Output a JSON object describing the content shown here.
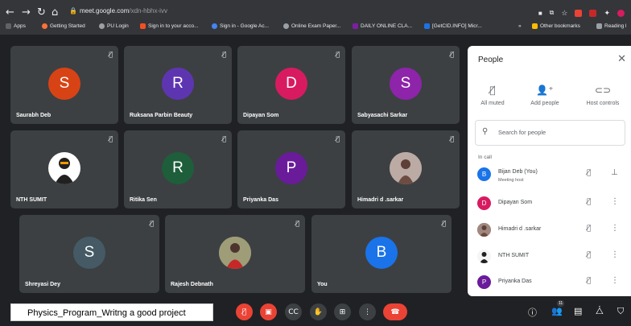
{
  "browser": {
    "url_host": "meet.google.com",
    "url_path": "/xdn-hbhx-ivv",
    "bookmarks": [
      {
        "label": "Apps",
        "color": "#5f6368"
      },
      {
        "label": "Getting Started",
        "color": "#ff7139"
      },
      {
        "label": "PU Login",
        "color": "#9aa0a6"
      },
      {
        "label": "Sign in to your acco...",
        "color": "#f25022"
      },
      {
        "label": "Sign in - Google Ac...",
        "color": "#4285f4"
      },
      {
        "label": "Online Exam Paper...",
        "color": "#9aa0a6"
      },
      {
        "label": "DAILY ONLINE CLA...",
        "color": "#7b1fa2"
      },
      {
        "label": "[GetCID.INFO] Micr...",
        "color": "#1a73e8"
      }
    ],
    "other_bookmarks": "Other bookmarks",
    "reading_list": "Reading l"
  },
  "tiles": [
    {
      "name": "Saurabh Deb",
      "initial": "S",
      "color": "#d84315"
    },
    {
      "name": "Ruksana Parbin Beauty",
      "initial": "R",
      "color": "#5e35b1"
    },
    {
      "name": "Dipayan Som",
      "initial": "D",
      "color": "#d81b60"
    },
    {
      "name": "Sabyasachi Sarkar",
      "initial": "S",
      "color": "#8e24aa"
    },
    {
      "name": "NTH SUMIT",
      "initial": "",
      "color": "#ffffff"
    },
    {
      "name": "Ritika Sen",
      "initial": "R",
      "color": "#1e5e3b"
    },
    {
      "name": "Priyanka Das",
      "initial": "P",
      "color": "#6a1b9a"
    },
    {
      "name": "Himadri d .sarkar",
      "initial": "",
      "color": "#8d6e63"
    },
    {
      "name": "Shreyasi Dey",
      "initial": "S",
      "color": "#455a64"
    },
    {
      "name": "Rajesh Debnath",
      "initial": "",
      "color": "#795548"
    },
    {
      "name": "You",
      "initial": "B",
      "color": "#1a73e8"
    }
  ],
  "people_panel": {
    "title": "People",
    "actions": [
      "All muted",
      "Add people",
      "Host controls"
    ],
    "search_placeholder": "Search for people",
    "section_label": "In call",
    "participants": [
      {
        "name": "Bijan Deb (You)",
        "sub": "Meeting host",
        "initial": "B",
        "color": "#1a73e8"
      },
      {
        "name": "Dipayan Som",
        "sub": "",
        "initial": "D",
        "color": "#d81b60"
      },
      {
        "name": "Himadri d .sarkar",
        "sub": "",
        "initial": "",
        "color": "#8d6e63"
      },
      {
        "name": "NTH SUMIT",
        "sub": "",
        "initial": "",
        "color": "#f5f5f5"
      },
      {
        "name": "Priyanka Das",
        "sub": "",
        "initial": "P",
        "color": "#6a1b9a"
      }
    ]
  },
  "meeting": {
    "title": "Physics_Program_Writng a good project",
    "participant_count": "11"
  },
  "colors": {
    "danger": "#ea4335",
    "control_gray": "#3c4043"
  }
}
